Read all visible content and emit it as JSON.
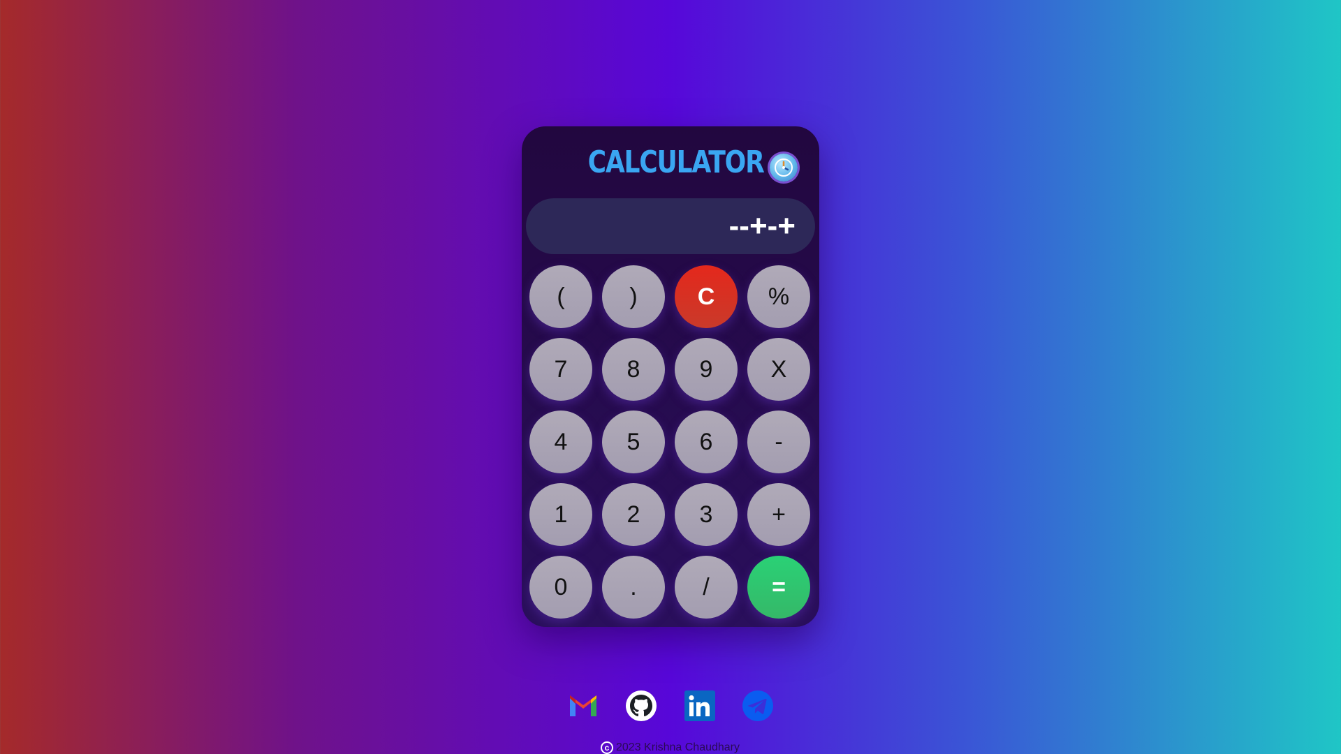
{
  "calculator": {
    "title": "CALCULATOR",
    "display": "--+-+",
    "keys": [
      {
        "label": "(",
        "kind": "normal"
      },
      {
        "label": ")",
        "kind": "normal"
      },
      {
        "label": "C",
        "kind": "clear"
      },
      {
        "label": "%",
        "kind": "normal"
      },
      {
        "label": "7",
        "kind": "normal"
      },
      {
        "label": "8",
        "kind": "normal"
      },
      {
        "label": "9",
        "kind": "normal"
      },
      {
        "label": "X",
        "kind": "normal"
      },
      {
        "label": "4",
        "kind": "normal"
      },
      {
        "label": "5",
        "kind": "normal"
      },
      {
        "label": "6",
        "kind": "normal"
      },
      {
        "label": "-",
        "kind": "normal"
      },
      {
        "label": "1",
        "kind": "normal"
      },
      {
        "label": "2",
        "kind": "normal"
      },
      {
        "label": "3",
        "kind": "normal"
      },
      {
        "label": "+",
        "kind": "normal"
      },
      {
        "label": "0",
        "kind": "normal"
      },
      {
        "label": ".",
        "kind": "normal"
      },
      {
        "label": "/",
        "kind": "normal"
      },
      {
        "label": "=",
        "kind": "equals"
      }
    ],
    "history_icon": "history-clock-icon"
  },
  "colors": {
    "title": "#3aa6f2",
    "clear_key": "#e4281c",
    "equals_key": "#2ad176",
    "normal_key": "#aaa4b5",
    "display_bg": "#2d2858"
  },
  "footer": {
    "socials": [
      {
        "name": "gmail-icon"
      },
      {
        "name": "github-icon"
      },
      {
        "name": "linkedin-icon"
      },
      {
        "name": "telegram-icon"
      }
    ],
    "copyright": "2023 Krishna Chaudhary"
  }
}
